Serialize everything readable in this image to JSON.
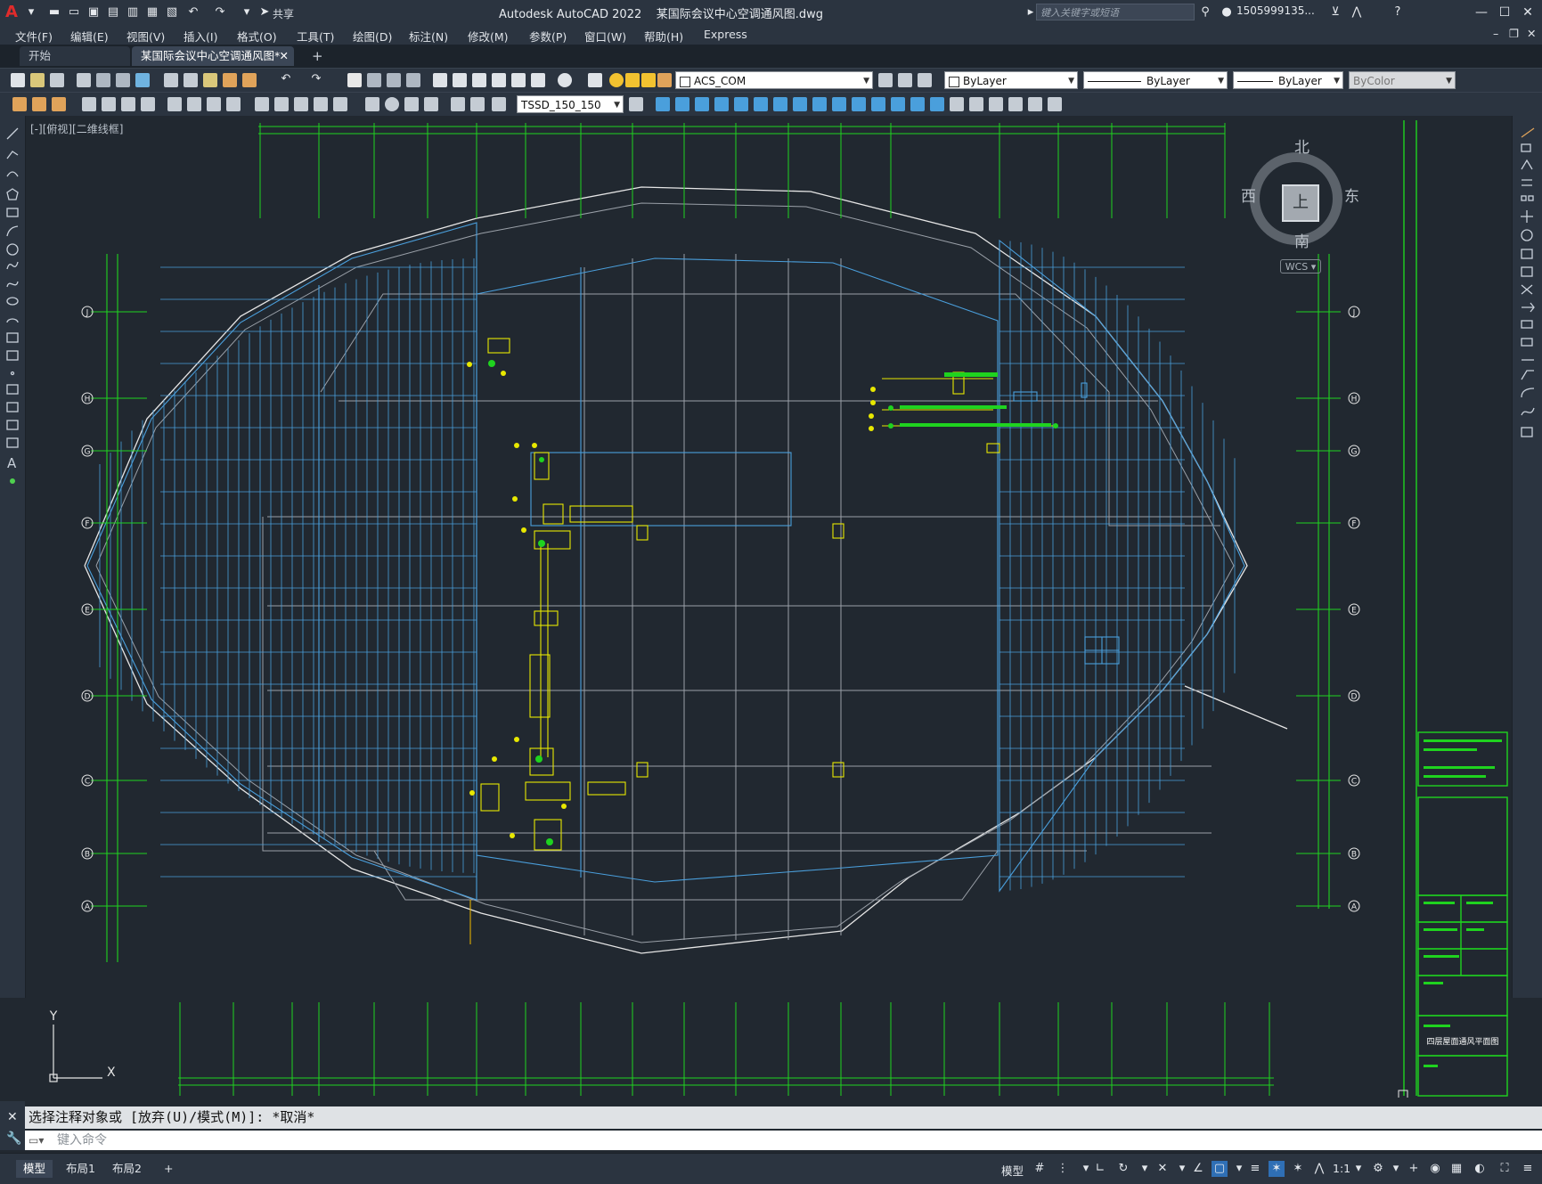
{
  "app": {
    "title": "Autodesk AutoCAD 2022",
    "document": "某国际会议中心空调通风图.dwg",
    "share_label": "共享"
  },
  "search": {
    "placeholder": "键入关键字或短语"
  },
  "user": {
    "name": "1505999135..."
  },
  "menu": [
    "文件(F)",
    "编辑(E)",
    "视图(V)",
    "插入(I)",
    "格式(O)",
    "工具(T)",
    "绘图(D)",
    "标注(N)",
    "修改(M)",
    "参数(P)",
    "窗口(W)",
    "帮助(H)",
    "Express"
  ],
  "tabs": [
    {
      "label": "开始"
    },
    {
      "label": "某国际会议中心空调通风图*"
    }
  ],
  "properties": {
    "layer": "ACS_COM",
    "color": "ByLayer",
    "linetype": "ByLayer",
    "lineweight": "ByLayer",
    "plotstyle": "ByColor",
    "dimstyle": "TSSD_150_150"
  },
  "viewport": {
    "label": "[-][俯视][二维线框]"
  },
  "viewcube": {
    "north": "北",
    "south": "南",
    "west": "西",
    "east": "东",
    "face": "上",
    "wcs": "WCS"
  },
  "axes": {
    "grid_rows": [
      "J",
      "H",
      "G",
      "F",
      "E",
      "D",
      "C",
      "B",
      "A"
    ]
  },
  "title_block": {
    "drawing_name": "四层屋面通风平面图"
  },
  "command": {
    "history": "选择注释对象或 [放弃(U)/模式(M)]: *取消*",
    "placeholder": "键入命令"
  },
  "layouts": [
    "模型",
    "布局1",
    "布局2"
  ],
  "status": {
    "model_label": "模型",
    "scale": "1:1"
  },
  "colors": {
    "grid": "#1fd31f",
    "duct": "#4a9fdc",
    "outline": "#e6e6e6",
    "equipment": "#e8e800"
  }
}
